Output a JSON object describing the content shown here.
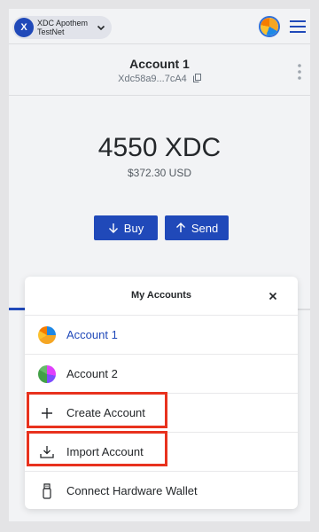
{
  "network": {
    "name": "XDC Apothem TestNet",
    "logo_letter": "X"
  },
  "account": {
    "name": "Account 1",
    "address": "Xdc58a9...7cA4"
  },
  "balance": {
    "amount": "4550 XDC",
    "fiat": "$372.30 USD"
  },
  "actions": {
    "buy_label": "Buy",
    "send_label": "Send"
  },
  "modal": {
    "title": "My Accounts",
    "accounts": [
      {
        "label": "Account 1",
        "selected": true
      },
      {
        "label": "Account 2",
        "selected": false
      }
    ],
    "create_label": "Create Account",
    "import_label": "Import Account",
    "hardware_label": "Connect Hardware Wallet"
  },
  "colors": {
    "accent": "#2049b9",
    "highlight": "#e8321e",
    "background": "#f2f3f5"
  },
  "icons": [
    "chevron-down-icon",
    "hamburger-menu-icon",
    "copy-icon",
    "kebab-menu-icon",
    "arrow-down-icon",
    "arrow-up-icon",
    "close-icon",
    "plus-icon",
    "import-icon",
    "usb-icon"
  ]
}
